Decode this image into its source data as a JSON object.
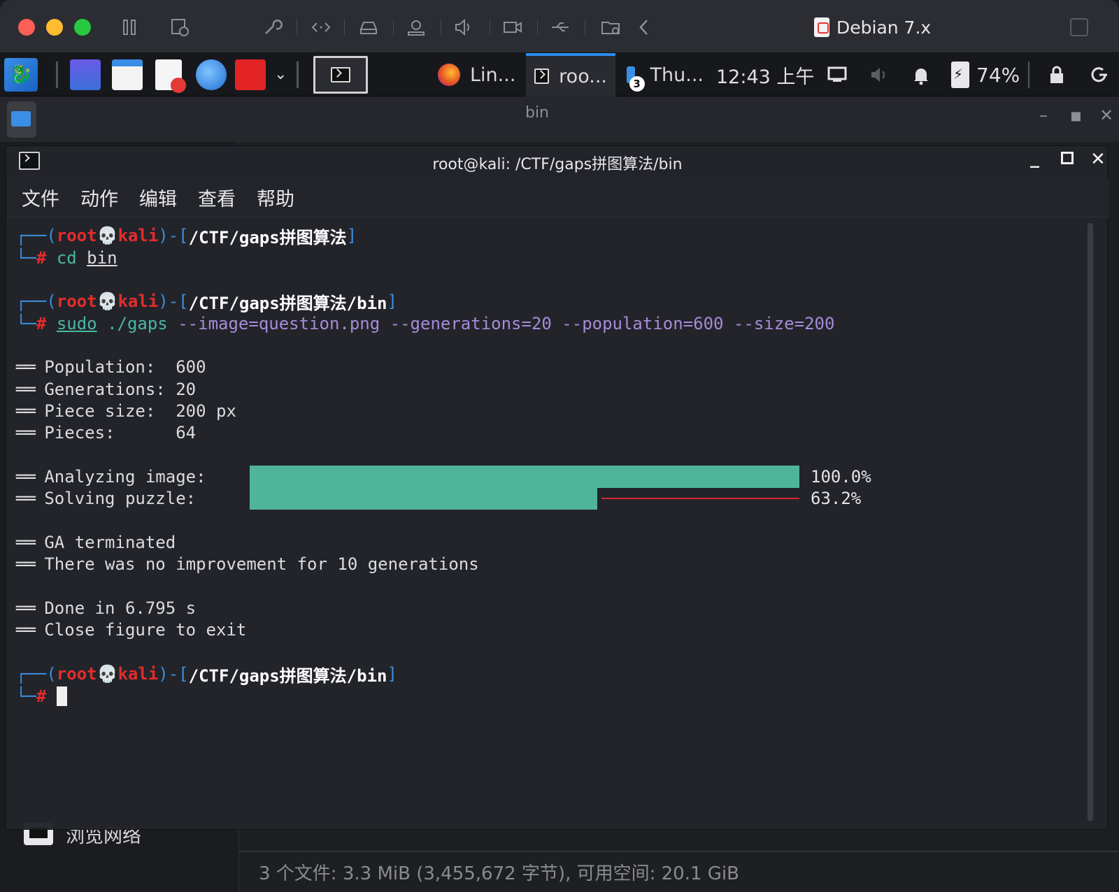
{
  "vm": {
    "title": "Debian 7.x"
  },
  "panel": {
    "tasks": [
      {
        "label": "Lin..."
      },
      {
        "label": "roo..."
      },
      {
        "label": "Thu...",
        "badge": "3"
      }
    ],
    "clock": "12:43 上午",
    "battery": "74%"
  },
  "filemanager": {
    "title": "bin",
    "sidebar_item": "浏览网络",
    "status": "3 个文件: 3.3 MiB (3,455,672 字节), 可用空间: 20.1 GiB"
  },
  "terminal": {
    "title": "root@kali: /CTF/gaps拼图算法/bin",
    "menu": [
      "文件",
      "动作",
      "编辑",
      "查看",
      "帮助"
    ],
    "user": "root",
    "host": "kali",
    "path1": "/CTF/gaps拼图算法",
    "path2": "/CTF/gaps拼图算法/bin",
    "cmd1_name": "cd",
    "cmd1_arg": "bin",
    "cmd2_name": "sudo",
    "cmd2_exe": "./gaps",
    "cmd2_args": "--image=question.png --generations=20 --population=600 --size=200",
    "info": [
      {
        "key": "Population:  ",
        "value": "600"
      },
      {
        "key": "Generations: ",
        "value": "20"
      },
      {
        "key": "Piece size:  ",
        "value": "200 px"
      },
      {
        "key": "Pieces:      ",
        "value": "64"
      }
    ],
    "progress": [
      {
        "label": "Analyzing image:",
        "fraction": 1.0,
        "text": "100.0%"
      },
      {
        "label": "Solving puzzle: ",
        "fraction": 0.632,
        "text": "63.2%"
      }
    ],
    "msg1": "GA terminated",
    "msg2": "There was no improvement for 10 generations",
    "msg3": "Done in 6.795 s",
    "msg4": "Close figure to exit"
  },
  "colors": {
    "accent": "#2b8cf0",
    "prompt_red": "#e42c2c",
    "prompt_blue": "#3b8ee0",
    "progress_fill": "#4fb59a",
    "progress_rest": "#d7262e"
  }
}
